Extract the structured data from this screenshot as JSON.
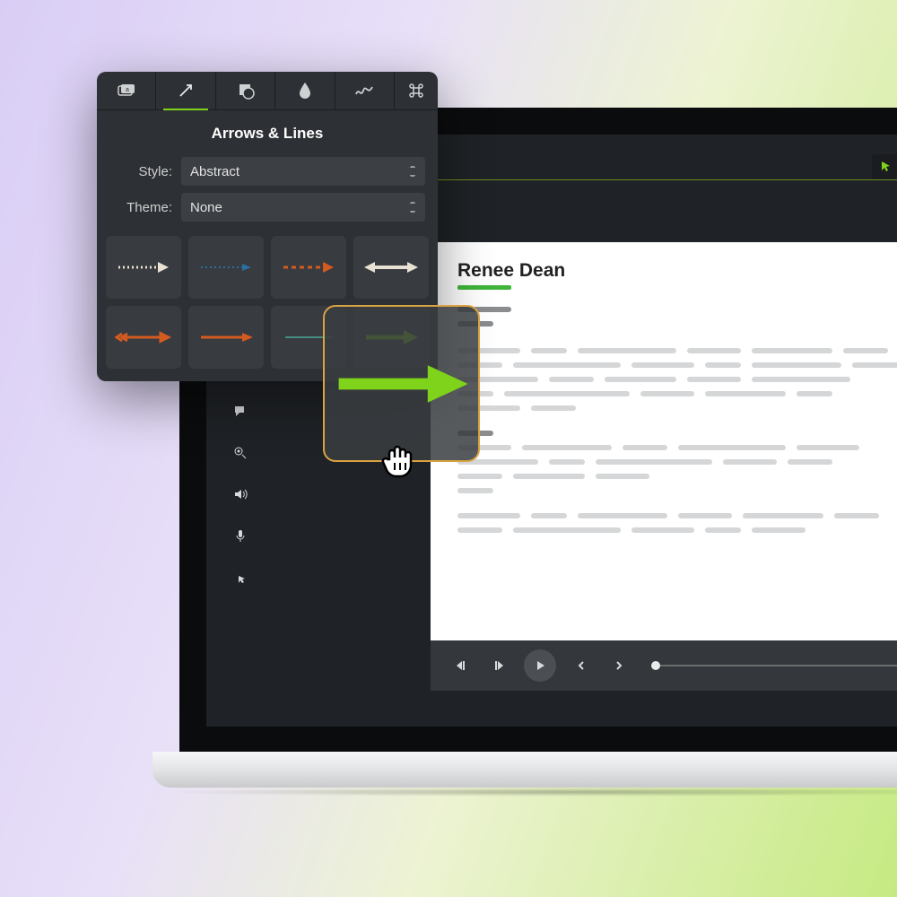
{
  "popover": {
    "title": "Arrows & Lines",
    "tabs": [
      "text-icon",
      "arrow-icon",
      "shape-icon",
      "drop-icon",
      "scribble-icon",
      "command-icon"
    ],
    "active_tab_index": 1,
    "style_label": "Style:",
    "style_value": "Abstract",
    "theme_label": "Theme:",
    "theme_value": "None",
    "arrow_styles": [
      "dotted-white",
      "dotted-blue",
      "dashed-orange",
      "double-white",
      "feather-orange",
      "solid-orange",
      "thin-teal",
      "solid-green"
    ]
  },
  "canvas": {
    "title": "Renee Dean",
    "mic_off": true
  },
  "accent": {
    "green": "#7fd31a",
    "orange": "#d45a20"
  }
}
